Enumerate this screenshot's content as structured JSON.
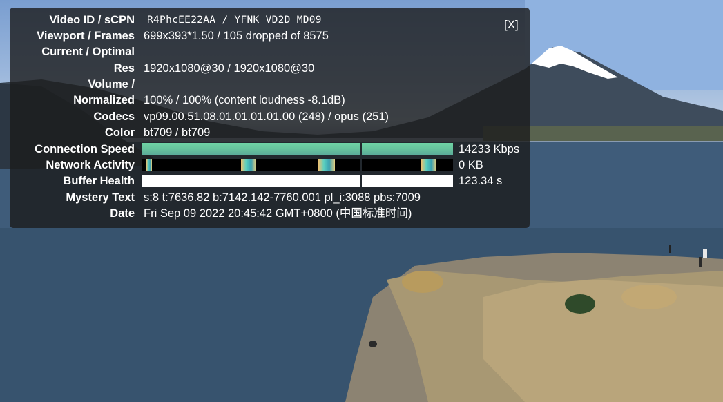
{
  "panel": {
    "close_label": "[X]",
    "rows": [
      {
        "label": "Video ID / sCPN",
        "value": "R4PhcEE22AA / YFNK VD2D MD09"
      },
      {
        "label": "Viewport / Frames",
        "value": "699x393*1.50 / 105 dropped of 8575"
      },
      {
        "label": "Current / Optimal",
        "value": ""
      },
      {
        "label": "Res",
        "value": "1920x1080@30 / 1920x1080@30"
      },
      {
        "label": "Volume /",
        "value": ""
      },
      {
        "label": "Normalized",
        "value": "100% / 100% (content loudness -8.1dB)"
      },
      {
        "label": "Codecs",
        "value": "vp09.00.51.08.01.01.01.01.00 (248) / opus (251)"
      },
      {
        "label": "Color",
        "value": "bt709 / bt709"
      },
      {
        "label": "Connection Speed",
        "value": "14233 Kbps"
      },
      {
        "label": "Network Activity",
        "value": "0 KB"
      },
      {
        "label": "Buffer Health",
        "value": "123.34 s"
      },
      {
        "label": "Mystery Text",
        "value": "s:8 t:7636.82 b:7142.142-7760.001 pl_i:3088 pbs:7009"
      },
      {
        "label": "Date",
        "value": "Fri Sep 09 2022 20:45:42 GMT+0800 (中国标准时间)"
      }
    ]
  },
  "colors": {
    "panel_bg": "#1c1c1c",
    "connection_speed_graph": "#67c39d",
    "network_activity_graph": "#000000",
    "buffer_health_graph": "#ffffff"
  }
}
